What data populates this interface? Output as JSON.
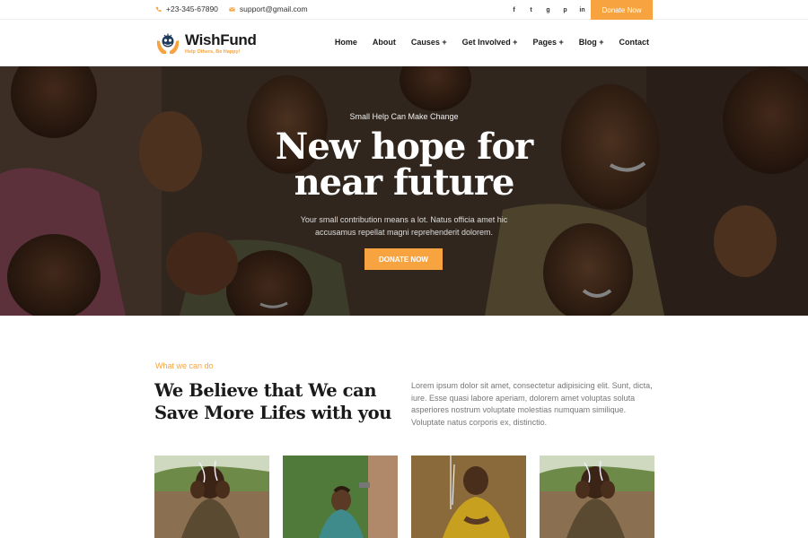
{
  "topbar": {
    "phone": "+23-345-67890",
    "email": "support@gmail.com",
    "social": [
      {
        "icon": "facebook-icon",
        "glyph": "f"
      },
      {
        "icon": "twitter-icon",
        "glyph": "t"
      },
      {
        "icon": "google-plus-icon",
        "glyph": "g"
      },
      {
        "icon": "pinterest-icon",
        "glyph": "p"
      },
      {
        "icon": "linkedin-icon",
        "glyph": "in"
      }
    ],
    "donate_label": "Donate Now"
  },
  "brand": {
    "name": "WishFund",
    "tagline": "Help Others, Be Happy!"
  },
  "nav": {
    "items": [
      "Home",
      "About",
      "Causes +",
      "Get Involved +",
      "Pages +",
      "Blog +",
      "Contact"
    ]
  },
  "hero": {
    "kicker": "Small Help Can Make Change",
    "title_line1": "New hope for",
    "title_line2": "near future",
    "subtitle": "Your small contribution means a lot. Natus officia amet hic accusamus repellat magni reprehenderit dolorem.",
    "button_label": "DONATE NOW"
  },
  "about": {
    "kicker": "What we can do",
    "heading": "We Believe that We can Save More Lifes with you",
    "paragraph": "Lorem ipsum dolor sit amet, consectetur adipisicing elit. Sunt, dicta, iure. Esse quasi labore aperiam, dolorem amet voluptas soluta asperiores nostrum voluptate molestias numquam similique. Voluptate natus corporis ex, distinctio."
  },
  "colors": {
    "accent": "#f7a440",
    "text_dark": "#1a1a1a",
    "text_muted": "#777777"
  }
}
